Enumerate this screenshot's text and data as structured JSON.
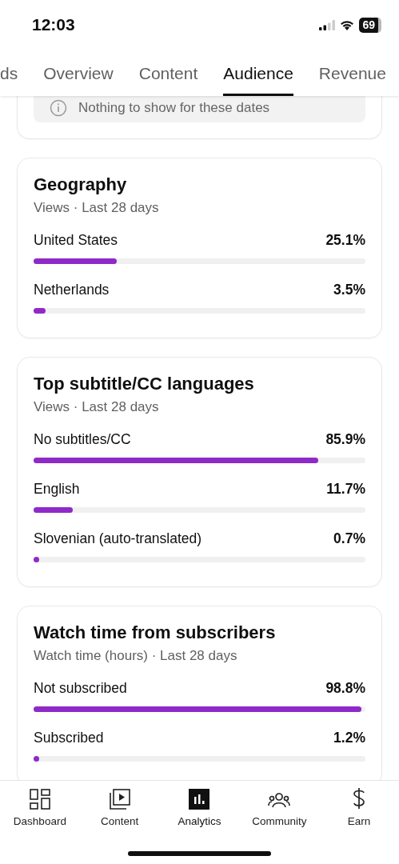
{
  "status_bar": {
    "time": "12:03",
    "battery": "69"
  },
  "tabs": [
    {
      "label": "ds",
      "selected": false
    },
    {
      "label": "Overview",
      "selected": false
    },
    {
      "label": "Content",
      "selected": false
    },
    {
      "label": "Audience",
      "selected": true
    },
    {
      "label": "Revenue",
      "selected": false
    }
  ],
  "cards": [
    {
      "kind": "notice",
      "message": "Nothing to show for these dates"
    },
    {
      "kind": "bars",
      "title": "Geography",
      "subtitle": "Views · Last 28 days",
      "rows": [
        {
          "label": "United States",
          "value": "25.1%",
          "level": 0.251
        },
        {
          "label": "Netherlands",
          "value": "3.5%",
          "level": 0.035
        }
      ]
    },
    {
      "kind": "bars",
      "title": "Top subtitle/CC languages",
      "subtitle": "Views · Last 28 days",
      "rows": [
        {
          "label": "No subtitles/CC",
          "value": "85.9%",
          "level": 0.859
        },
        {
          "label": "English",
          "value": "11.7%",
          "level": 0.117
        },
        {
          "label": "Slovenian (auto-translated)",
          "value": "0.7%",
          "level": 0.007
        }
      ]
    },
    {
      "kind": "bars",
      "title": "Watch time from subscribers",
      "subtitle": "Watch time (hours) · Last 28 days",
      "rows": [
        {
          "label": "Not subscribed",
          "value": "98.8%",
          "level": 0.988
        },
        {
          "label": "Subscribed",
          "value": "1.2%",
          "level": 0.012
        }
      ]
    }
  ],
  "bottom_nav": [
    {
      "label": "Dashboard",
      "kind": "dashboard",
      "selected": false
    },
    {
      "label": "Content",
      "kind": "content",
      "selected": false
    },
    {
      "label": "Analytics",
      "kind": "analytics",
      "selected": true
    },
    {
      "label": "Community",
      "kind": "community",
      "selected": false
    },
    {
      "label": "Earn",
      "kind": "earn",
      "selected": false
    }
  ]
}
